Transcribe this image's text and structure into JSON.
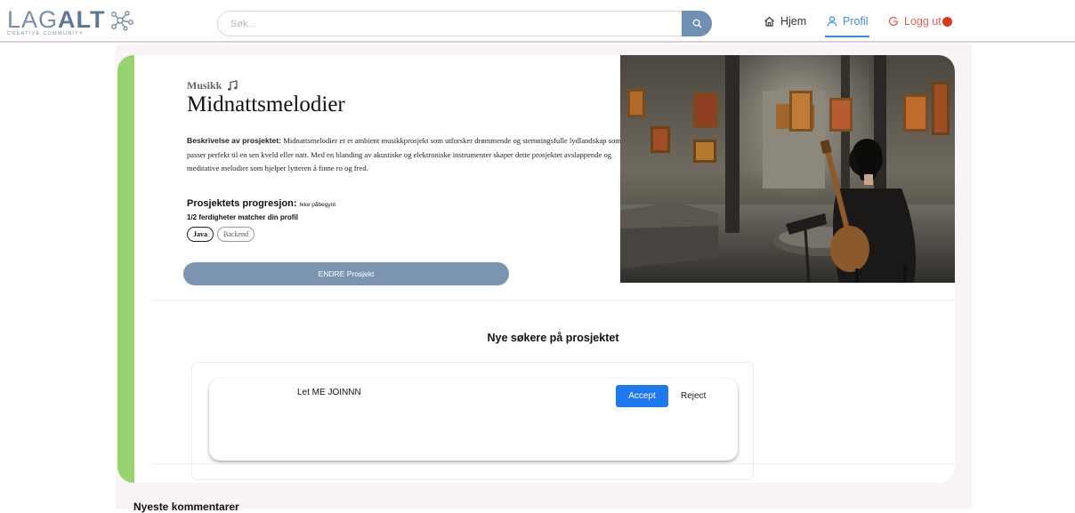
{
  "header": {
    "logo_text_light": "LAG",
    "logo_text_bold": "ALT",
    "logo_subtitle": "CREATIVE COMMUNITY",
    "search_placeholder": "Søk...",
    "nav": {
      "home": "Hjem",
      "profile": "Profil",
      "logout": "Logg ut"
    }
  },
  "project": {
    "category": "Musikk",
    "title": "Midnattsmelodier",
    "description_label": "Beskrivelse av prosjektet:",
    "description": "Midnattsmelodier er et ambient musikkprosjekt som utforsker drømmende og stemningsfulle lydlandskap som passer perfekt til en sen kveld eller natt. Med en blanding av akustiske og elektroniske instrumenter skaper dette prosjektet avslappende og meditative melodier som hjelper lytteren å finne ro og fred.",
    "progress_label": "Prosjektets progresjon:",
    "progress_status": "Ikke påbegynt",
    "skills_match": "1/2 ferdigheter matcher din profil",
    "skills": [
      {
        "label": "Java",
        "matched": true
      },
      {
        "label": "Backend",
        "matched": false
      }
    ],
    "edit_button": "ENDRE Prosjekt"
  },
  "applicants": {
    "title": "Nye søkere på prosjektet",
    "items": [
      {
        "message": "Let ME JOINNN",
        "accept": "Accept",
        "reject": "Reject"
      }
    ]
  },
  "comments": {
    "title": "Nyeste kommentarer"
  },
  "colors": {
    "accent_green": "#97d36e",
    "primary_blue": "#7b95b1",
    "accept_blue": "#1e78f0",
    "logout_red": "#ef5a55",
    "profile_blue": "#3d8be8"
  }
}
